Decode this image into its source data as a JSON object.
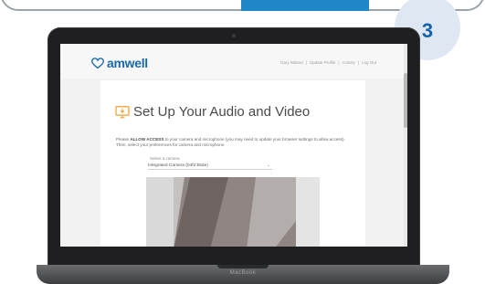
{
  "step": {
    "number": "3"
  },
  "colors": {
    "accent_blue": "#1f86c8",
    "step_text": "#1463ad",
    "step_bg": "#dfe7f3",
    "logo_blue": "#1b6aa8"
  },
  "laptop": {
    "brand": "MacBook"
  },
  "site": {
    "logo_text": "amwell",
    "nav": [
      "Gary Wiland",
      "|",
      "Update Profile",
      "|",
      "Activity",
      "|",
      "Log Out"
    ]
  },
  "setup": {
    "title": "Set Up Your Audio and Video",
    "intro_bold": "ALLOW ACCESS",
    "intro_before": "Please ",
    "intro_after": " to your camera and microphone (you may need to update your browser settings to allow access). Then, select your preferences for camera and microphone.",
    "select_label": "Select a camera",
    "select_value": "Integrated Camera (04f2:b5de)"
  },
  "icons": {
    "logo": "heart-outline-icon",
    "title": "monitor-download-icon",
    "dropdown": "chevron-down-icon"
  }
}
